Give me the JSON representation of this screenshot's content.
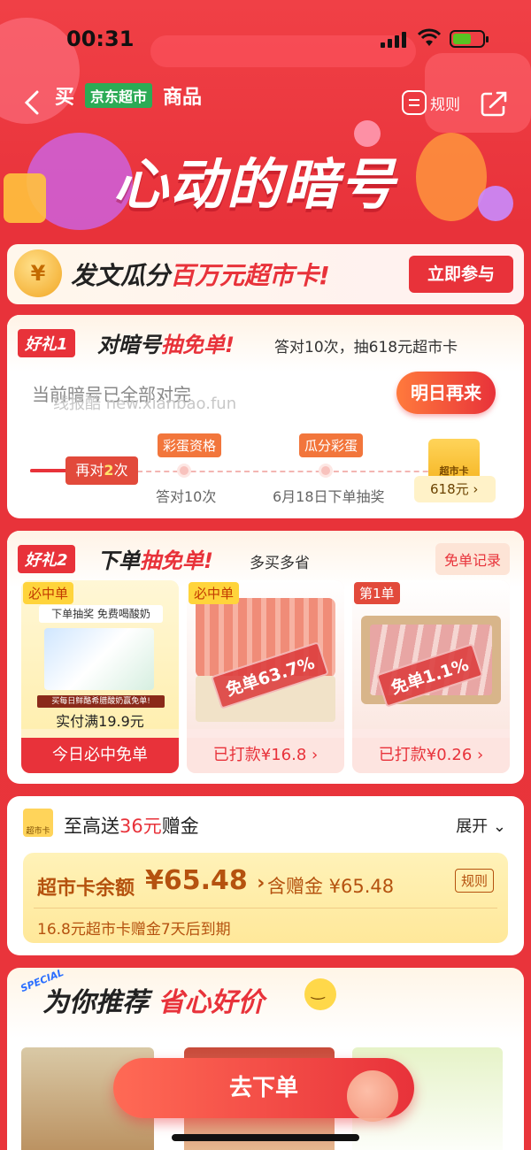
{
  "status": {
    "time": "00:31",
    "battery_color": "#58c322"
  },
  "nav": {
    "buy": "买",
    "jd_badge": "京东超市",
    "goods": "商品",
    "rules": "规则"
  },
  "hero": {
    "title": "心动的暗号"
  },
  "banner": {
    "coin": "¥",
    "title_a": "发文瓜分",
    "title_b": "百万元超市卡!",
    "button": "立即参与"
  },
  "gift1": {
    "tag": "好礼1",
    "title_a": "对暗号",
    "title_b": "抽免单!",
    "sub": "答对10次，抽618元超市卡",
    "status": "当前暗号已全部对完",
    "watermark": "线报酷 new.xianbao.fun",
    "button": "明日再来",
    "progress_prefix": "再对",
    "progress_num": "2",
    "progress_suffix": "次",
    "node1_tag": "彩蛋资格",
    "node1_label": "答对10次",
    "node2_tag": "瓜分彩蛋",
    "node2_label": "6月18日下单抽奖",
    "prize_card": "超市卡",
    "prize_amount": "618元 ›"
  },
  "gift2": {
    "tag": "好礼2",
    "title_a": "下单",
    "title_b": "抽免单!",
    "sub": "多买多省",
    "records": "免单记录",
    "products": [
      {
        "tag": "必中单",
        "img_line1": "下单抽奖 免费喝酸奶",
        "img_caption": "买每日鲜酪希腊酸奶赢免单!",
        "price": "实付满19.9元",
        "footer": "今日必中免单"
      },
      {
        "tag": "必中单",
        "stamp": "免单63.7%",
        "footer": "已打款¥16.8 ›"
      },
      {
        "tag": "第1单",
        "stamp": "免单1.1%",
        "footer": "已打款¥0.26 ›"
      }
    ]
  },
  "supermarket": {
    "icon_text": "超市卡",
    "title_a": "至高送",
    "title_b": "36元",
    "title_c": "赠金",
    "expand": "展开",
    "balance_label": "超市卡余额",
    "balance_value": "¥65.48",
    "balance_arrow": "›",
    "gift_label": "含赠金 ¥65.48",
    "rule": "规则",
    "expire": "16.8元超市卡赠金7天后到期"
  },
  "recommend": {
    "special": "SPECIAL",
    "title_a": "为你推荐",
    "title_b": "省心好价"
  },
  "cta": {
    "label": "去下单"
  }
}
